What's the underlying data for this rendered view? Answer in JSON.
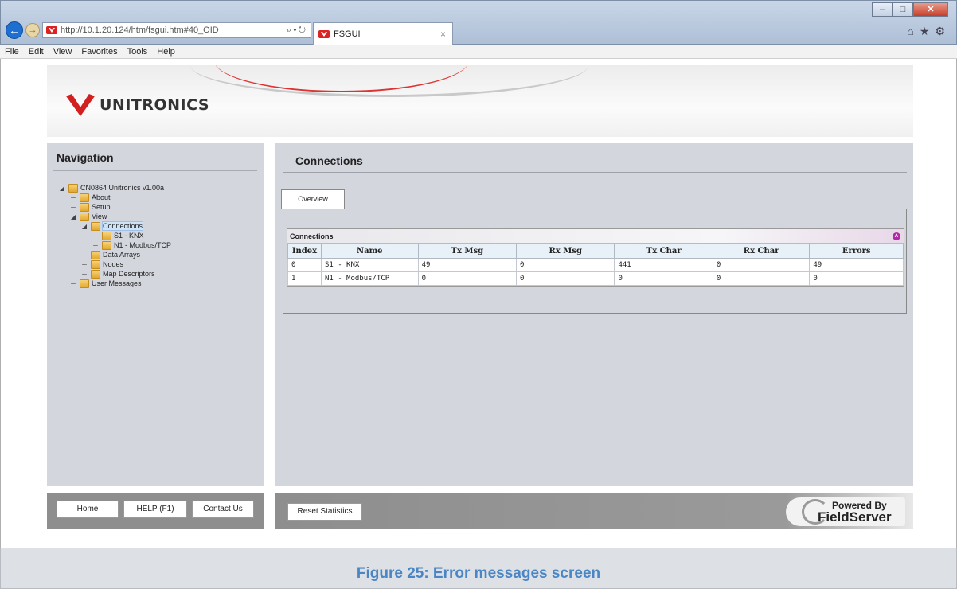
{
  "browser": {
    "url": "http://10.1.20.124/htm/fsgui.htm#40_OID",
    "tab_title": "FSGUI",
    "menu": [
      "File",
      "Edit",
      "View",
      "Favorites",
      "Tools",
      "Help"
    ]
  },
  "header": {
    "logo_text": "UNITRONICS"
  },
  "navigation": {
    "title": "Navigation",
    "tree": [
      {
        "label": "CN0864 Unitronics v1.00a",
        "level": 0,
        "expanded": true
      },
      {
        "label": "About",
        "level": 1
      },
      {
        "label": "Setup",
        "level": 1
      },
      {
        "label": "View",
        "level": 1,
        "expanded": true
      },
      {
        "label": "Connections",
        "level": 2,
        "expanded": true,
        "selected": true
      },
      {
        "label": "S1 - KNX",
        "level": 3
      },
      {
        "label": "N1 - Modbus/TCP",
        "level": 3
      },
      {
        "label": "Data Arrays",
        "level": 2
      },
      {
        "label": "Nodes",
        "level": 2
      },
      {
        "label": "Map Descriptors",
        "level": 2
      },
      {
        "label": "User Messages",
        "level": 1
      }
    ]
  },
  "main": {
    "title": "Connections",
    "tab_label": "Overview",
    "grid_caption": "Connections",
    "columns": [
      "Index",
      "Name",
      "Tx Msg",
      "Rx Msg",
      "Tx Char",
      "Rx Char",
      "Errors"
    ],
    "rows": [
      [
        "0",
        "S1 - KNX",
        "49",
        "0",
        "441",
        "0",
        "49"
      ],
      [
        "1",
        "N1 - Modbus/TCP",
        "0",
        "0",
        "0",
        "0",
        "0"
      ]
    ]
  },
  "footer": {
    "home": "Home",
    "help": "HELP (F1)",
    "contact": "Contact Us",
    "reset": "Reset Statistics",
    "powered_by": "Powered By",
    "powered_brand": "FieldServer"
  },
  "caption": "Figure 25: Error messages screen",
  "colors": {
    "accent_red": "#d21f1f",
    "caption_blue": "#4a86c5",
    "panel": "#d4d6de"
  }
}
